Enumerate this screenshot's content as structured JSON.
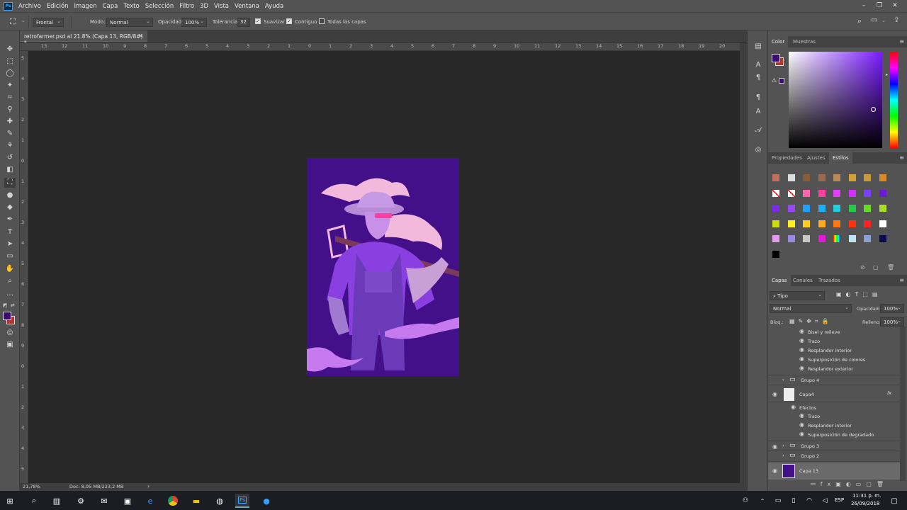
{
  "app": {
    "logo": "Ps"
  },
  "menu": [
    "Archivo",
    "Edición",
    "Imagen",
    "Capa",
    "Texto",
    "Selección",
    "Filtro",
    "3D",
    "Vista",
    "Ventana",
    "Ayuda"
  ],
  "options": {
    "fill_source": "Frontal",
    "mode_label": "Modo:",
    "mode_value": "Normal",
    "opacity_label": "Opacidad:",
    "opacity_value": "100%",
    "tolerance_label": "Tolerancia:",
    "tolerance_value": "32",
    "smooth_label": "Suavizar",
    "contiguous_label": "Contiguo",
    "all_layers_label": "Todas las capas"
  },
  "document": {
    "tab_title": "retrofarmer.psd al 21.8% (Capa 13, RGB/8#) *",
    "close": "×"
  },
  "ruler_top": [
    "13",
    "12",
    "11",
    "10",
    "9",
    "8",
    "7",
    "6",
    "5",
    "4",
    "3",
    "2",
    "1",
    "0",
    "1",
    "2",
    "3",
    "4",
    "5",
    "6",
    "7",
    "8",
    "9",
    "10",
    "11",
    "12",
    "13",
    "14",
    "15",
    "16",
    "17",
    "18",
    "19",
    "20"
  ],
  "ruler_left": [
    "5",
    "4",
    "3",
    "2",
    "1",
    "0",
    "1",
    "2",
    "3",
    "4",
    "5",
    "6",
    "7",
    "8",
    "9",
    "0",
    "1",
    "2",
    "3",
    "4",
    "5"
  ],
  "status": {
    "zoom": "21,78%",
    "doc": "Doc: 8,95 MB/223,2 MB"
  },
  "color_panel": {
    "tabs": [
      "Color",
      "Muestras"
    ]
  },
  "styles_panel": {
    "tabs": [
      "Propiedades",
      "Ajustes",
      "Estilos"
    ]
  },
  "styles_swatches": [
    "#ff66b2",
    "#ff3fa0",
    "#e040fb",
    "#cc33ff",
    "#7b3fff",
    "#6a1bd6",
    "#7c2ae8",
    "#9a44ff",
    "#1ea0ff",
    "#1eb0ff",
    "#20d0e0",
    "#22cc44",
    "#66dd22",
    "#aadd22",
    "#ccdd11",
    "#ffee22",
    "#ffcc22",
    "#ffaa22",
    "#ff7711",
    "#ff3311",
    "#ff2222",
    "#ffffff"
  ],
  "layers_panel": {
    "tabs": [
      "Capas",
      "Canales",
      "Trazados"
    ],
    "filter": "Tipo",
    "blend": "Normal",
    "opacity_label": "Opacidad:",
    "opacity_value": "100%",
    "lock_label": "Bloq.:",
    "fill_label": "Relleno:",
    "fill_value": "100%",
    "rows": [
      {
        "name": "Bisel y relieve"
      },
      {
        "name": "Trazo"
      },
      {
        "name": "Resplandor interior"
      },
      {
        "name": "Superposición de colores"
      },
      {
        "name": "Resplandor exterior"
      },
      {
        "name": "Grupo 4"
      },
      {
        "name": "Capa4"
      },
      {
        "name": "Efectos"
      },
      {
        "name": "Trazo"
      },
      {
        "name": "Resplandor interior"
      },
      {
        "name": "Superposición de degradado"
      },
      {
        "name": "Grupo 3"
      },
      {
        "name": "Grupo 2"
      },
      {
        "name": "Capa 13"
      }
    ]
  },
  "taskbar": {
    "lang": "ESP",
    "time": "11:31 p. m.",
    "date": "26/09/2018"
  },
  "colors": {
    "foreground": "#3a0a73",
    "background": "#b3362d",
    "canvas_bg": "#43108a"
  }
}
